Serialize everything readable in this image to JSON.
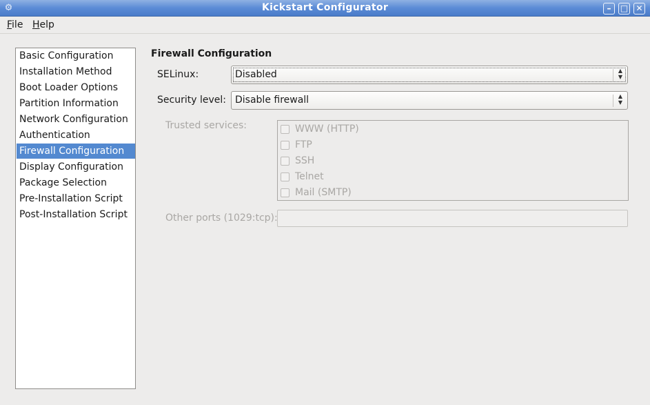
{
  "window": {
    "title": "Kickstart Configurator",
    "app_icon": "app-gear-icon",
    "controls": [
      "minimize-icon",
      "maximize-icon",
      "close-icon"
    ]
  },
  "menubar": {
    "file": {
      "mnemonic": "F",
      "rest": "ile"
    },
    "help": {
      "mnemonic": "H",
      "rest": "elp"
    }
  },
  "sidebar": {
    "selected_index": 6,
    "items": [
      {
        "label": "Basic Configuration"
      },
      {
        "label": "Installation Method"
      },
      {
        "label": "Boot Loader Options"
      },
      {
        "label": "Partition Information"
      },
      {
        "label": "Network Configuration"
      },
      {
        "label": "Authentication"
      },
      {
        "label": "Firewall Configuration"
      },
      {
        "label": "Display Configuration"
      },
      {
        "label": "Package Selection"
      },
      {
        "label": "Pre-Installation Script"
      },
      {
        "label": "Post-Installation Script"
      }
    ]
  },
  "firewall": {
    "title": "Firewall Configuration",
    "selinux_label": "SELinux:",
    "selinux_value": "Disabled",
    "security_label": "Security level:",
    "security_value": "Disable firewall",
    "trusted_label": "Trusted services:",
    "services": [
      {
        "label": "WWW (HTTP)",
        "checked": false
      },
      {
        "label": "FTP",
        "checked": false
      },
      {
        "label": "SSH",
        "checked": false
      },
      {
        "label": "Telnet",
        "checked": false
      },
      {
        "label": "Mail (SMTP)",
        "checked": false
      }
    ],
    "other_ports_label": "Other ports (1029:tcp):",
    "other_ports_value": ""
  },
  "colors": {
    "selection": "#5389d0",
    "titlebar": "#5b8bd6",
    "disabled_text": "#a9a7a4"
  }
}
